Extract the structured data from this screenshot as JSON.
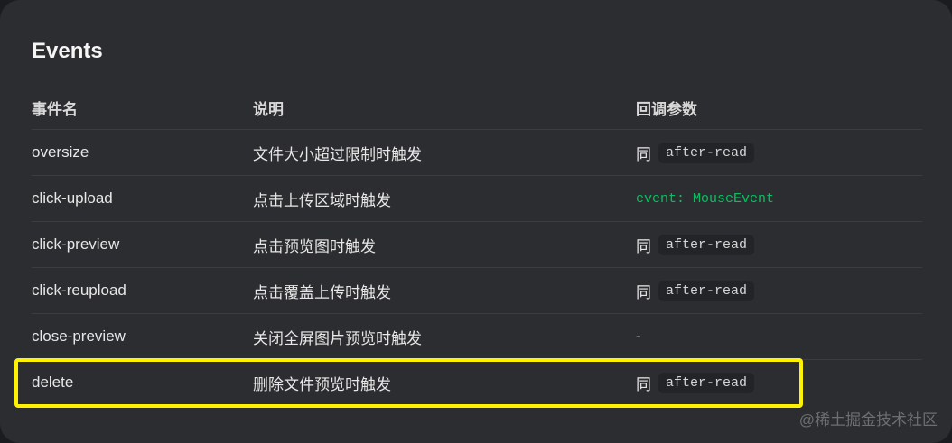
{
  "section_title": "Events",
  "table": {
    "headers": [
      "事件名",
      "说明",
      "回调参数"
    ],
    "rows": [
      {
        "name": "oversize",
        "desc": "文件大小超过限制时触发",
        "param_prefix": "同",
        "param_code": "after-read"
      },
      {
        "name": "click-upload",
        "desc": "点击上传区域时触发",
        "param_prefix": "",
        "param_code": "event: MouseEvent"
      },
      {
        "name": "click-preview",
        "desc": "点击预览图时触发",
        "param_prefix": "同",
        "param_code": "after-read"
      },
      {
        "name": "click-reupload",
        "desc": "点击覆盖上传时触发",
        "param_prefix": "同",
        "param_code": "after-read"
      },
      {
        "name": "close-preview",
        "desc": "关闭全屏图片预览时触发",
        "param_text": "-"
      },
      {
        "name": "delete",
        "desc": "删除文件预览时触发",
        "param_prefix": "同",
        "param_code": "after-read"
      }
    ]
  },
  "watermark": "@稀土掘金技术社区",
  "colors": {
    "page_bg": "#1b1c1f",
    "card_bg": "#2c2d30",
    "code_bg": "#232427",
    "accent_green": "#07c160",
    "highlight_yellow": "#fff200"
  }
}
